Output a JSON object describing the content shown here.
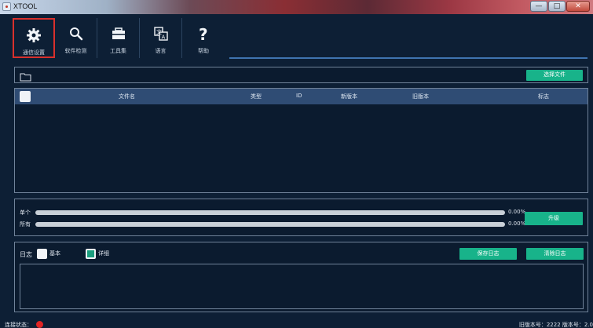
{
  "window": {
    "title": "XTOOL",
    "buttons": {
      "minimize": "—",
      "maximize": "□",
      "close": "✕"
    }
  },
  "toolbar": {
    "items": [
      {
        "label": "通信设置",
        "icon": "gear-icon",
        "active": true
      },
      {
        "label": "软件检测",
        "icon": "search-icon",
        "active": false
      },
      {
        "label": "工具集",
        "icon": "toolbox-icon",
        "active": false
      },
      {
        "label": "语言",
        "icon": "language-icon",
        "active": false
      },
      {
        "label": "帮助",
        "icon": "help-icon",
        "active": false
      }
    ]
  },
  "file_bar": {
    "choose_file_label": "选择文件"
  },
  "table": {
    "columns": [
      "文件名",
      "类型",
      "ID",
      "新版本",
      "旧版本",
      "标志"
    ],
    "rows": []
  },
  "progress": {
    "single": {
      "label": "单个",
      "value": 0,
      "text": "0.00%"
    },
    "all": {
      "label": "所有",
      "value": 0,
      "text": "0.00%"
    },
    "upgrade_label": "升级"
  },
  "log": {
    "title": "日志",
    "mode_basic": "基本",
    "mode_detail": "详细",
    "save_label": "保存日志",
    "clear_label": "清除日志"
  },
  "status": {
    "left": "连接状态：",
    "right": "旧版本号：2222 版本号：2.0"
  },
  "colors": {
    "accent_green": "#18b38a",
    "active_border": "#d9302c",
    "header_blue": "#2f4c74",
    "background": "#0d1f35"
  }
}
